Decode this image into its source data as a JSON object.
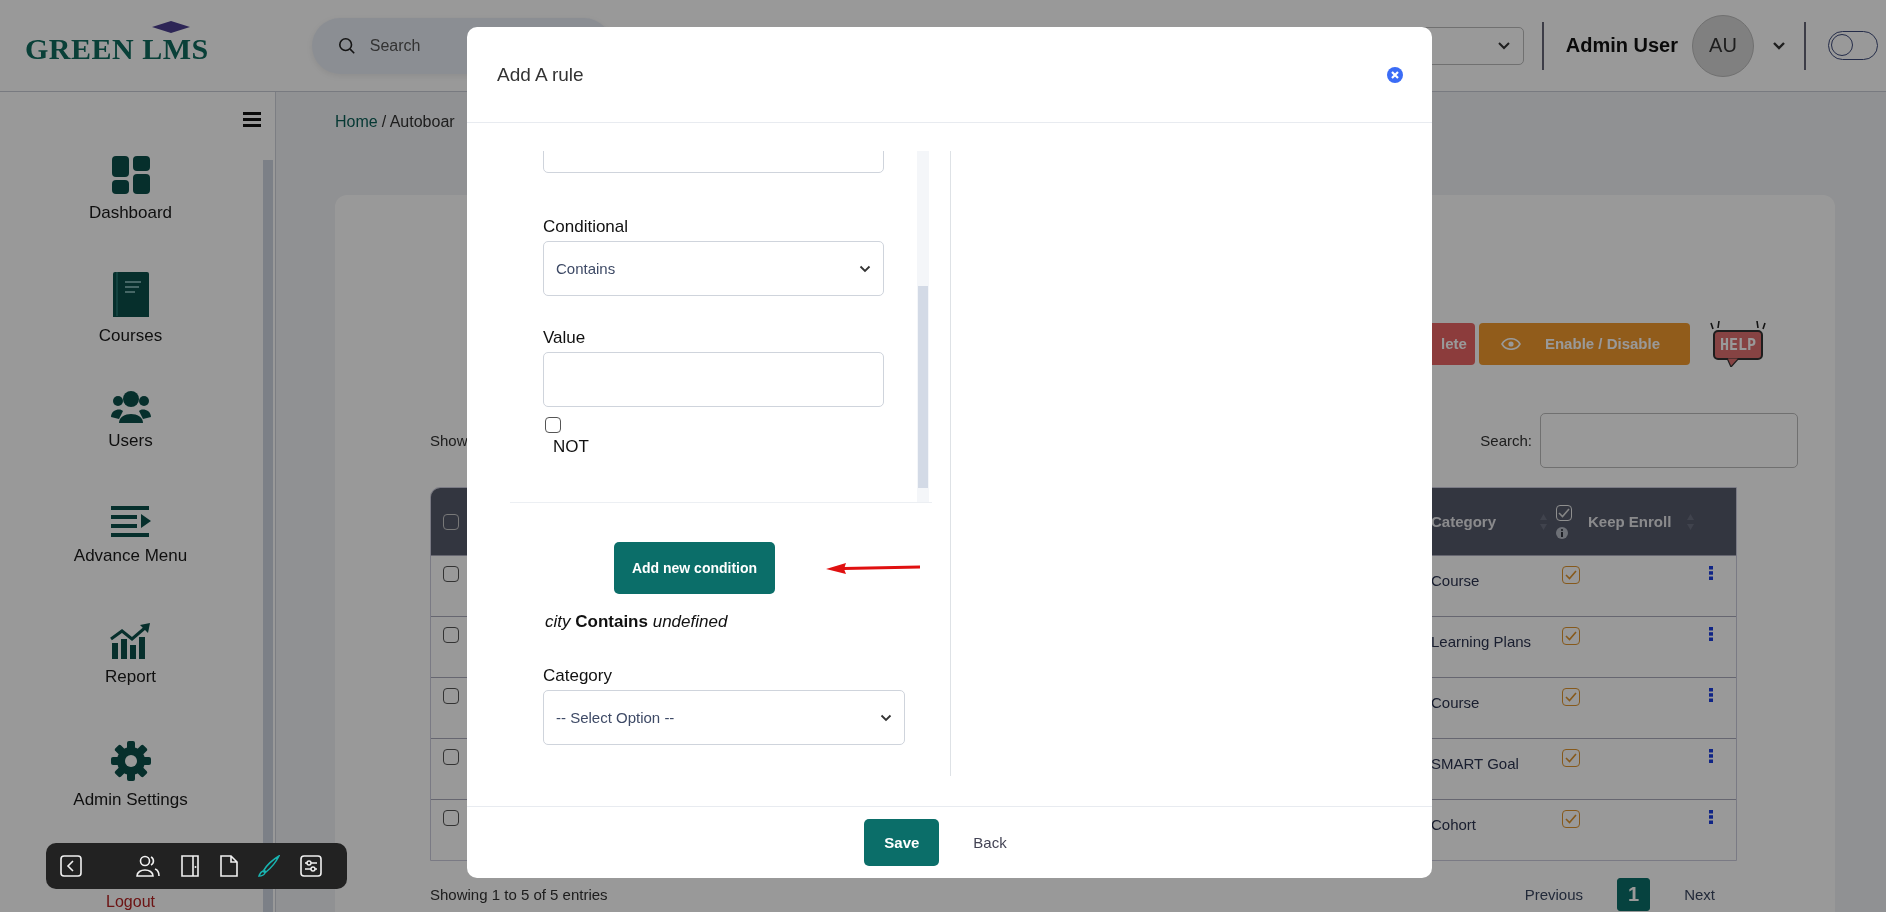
{
  "header": {
    "logo": "GREEN LMS",
    "search": {
      "placeholder": "Search"
    },
    "user": {
      "name": "Admin User",
      "initials": "AU"
    },
    "dark_mode": {
      "on": false
    }
  },
  "sidebar": {
    "items": [
      {
        "label": "Dashboard",
        "kind": "grid"
      },
      {
        "label": "Courses",
        "kind": "book"
      },
      {
        "label": "Users",
        "kind": "users"
      },
      {
        "label": "Advance Menu",
        "kind": "menu"
      },
      {
        "label": "Report",
        "kind": "chart"
      },
      {
        "label": "Admin Settings",
        "kind": "gear"
      }
    ],
    "logout": "Logout"
  },
  "toolbar": {
    "items": [
      {
        "kind": "back",
        "selected": false
      },
      {
        "kind": "users",
        "selected": false
      },
      {
        "kind": "door",
        "selected": false
      },
      {
        "kind": "file",
        "selected": false
      },
      {
        "kind": "brush",
        "selected": true
      },
      {
        "kind": "sliders",
        "selected": false
      }
    ]
  },
  "breadcrumb": [
    {
      "label": "Home",
      "kind": "link"
    },
    {
      "label": "/ Autoboar",
      "kind": "current"
    }
  ],
  "actions": [
    {
      "label": "lete",
      "kind": "danger"
    },
    {
      "label": "Enable / Disable",
      "kind": "warning"
    }
  ],
  "help": "HELP",
  "table": {
    "length_label": "Show",
    "search_label": "Search:",
    "select_all": {
      "checked": false
    },
    "columns": [
      {
        "label": "Category"
      },
      {
        "label": "Keep Enroll",
        "checked": true
      }
    ],
    "rows": [
      {
        "checked": false,
        "category": "Course",
        "keep_enroll": true
      },
      {
        "checked": false,
        "category": "Learning Plans",
        "keep_enroll": true
      },
      {
        "checked": false,
        "category": "Course",
        "keep_enroll": true
      },
      {
        "checked": false,
        "category": "SMART Goal",
        "keep_enroll": true
      },
      {
        "checked": false,
        "category": "Cohort",
        "keep_enroll": true
      }
    ],
    "info": "Showing 1 to 5 of 5 entries",
    "pagination": [
      {
        "label": "Previous",
        "kind": "nav",
        "selected": false
      },
      {
        "label": "1",
        "kind": "page",
        "selected": true
      },
      {
        "label": "Next",
        "kind": "nav",
        "selected": false
      }
    ]
  },
  "modal": {
    "title": "Add A rule",
    "fields": [
      {
        "label": "Conditional",
        "kind": "select",
        "value": "Contains"
      },
      {
        "label": "Value",
        "kind": "input"
      }
    ],
    "not": {
      "label": "NOT",
      "checked": false
    },
    "add_button": "Add new condition",
    "summary": "*city* **Contains** *undefined*",
    "category": {
      "label": "Category",
      "value": "-- Select Option --"
    },
    "buttons": [
      {
        "label": "Save",
        "kind": "primary"
      },
      {
        "label": "Back",
        "kind": "link"
      }
    ]
  }
}
